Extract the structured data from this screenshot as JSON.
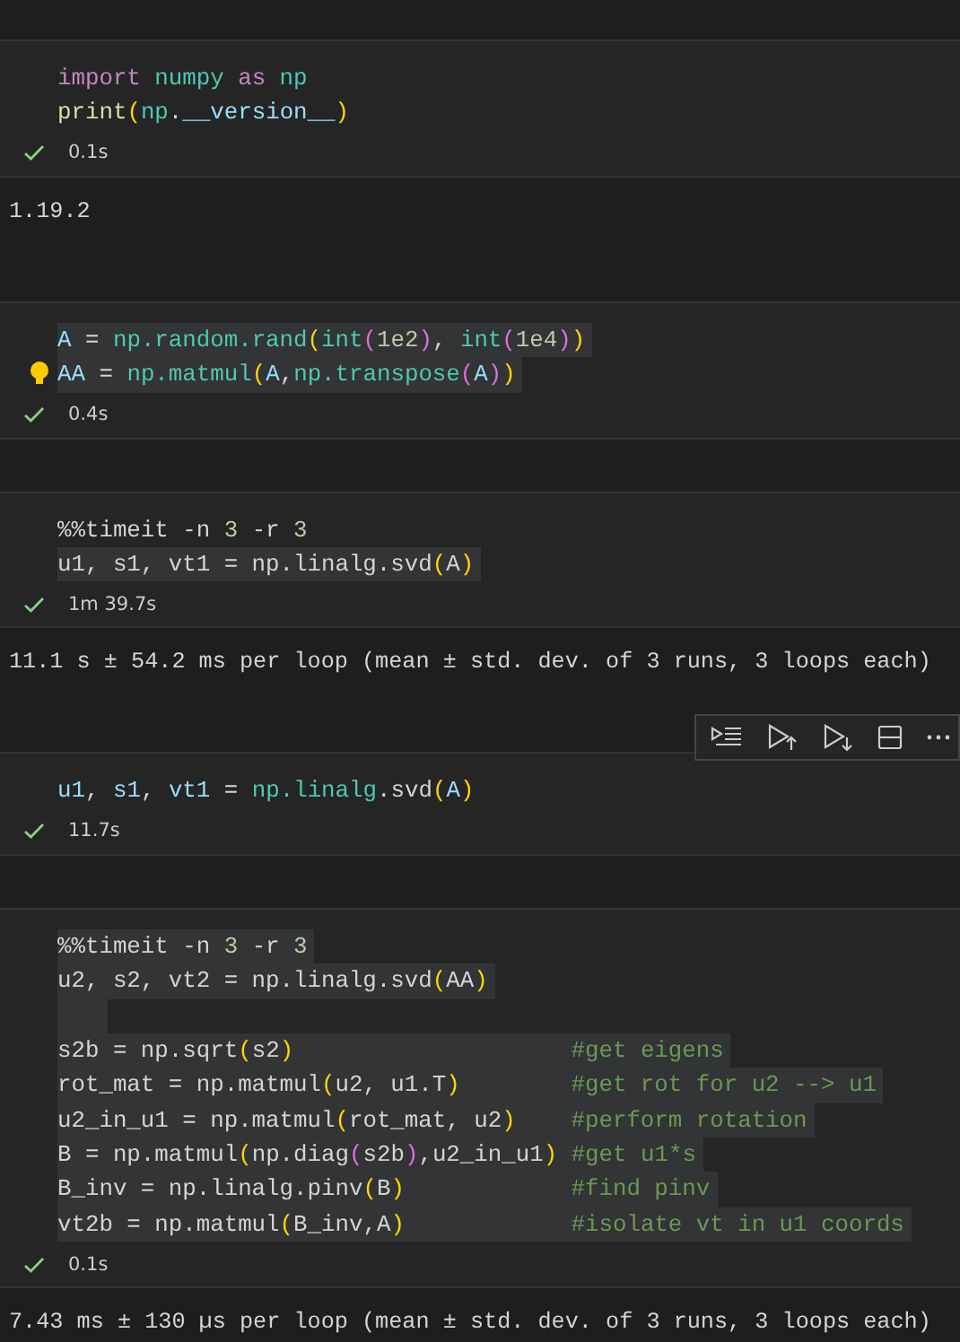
{
  "cells": [
    {
      "toolbar_shown": false,
      "lines": [
        {
          "highlighted": false,
          "tokens": [
            {
              "t": "import",
              "kind": "keyword"
            },
            {
              "t": " numpy",
              "kind": "module"
            },
            {
              "t": " as",
              "kind": "keyword"
            },
            {
              "t": " np",
              "kind": "module"
            }
          ]
        },
        {
          "highlighted": false,
          "tokens": [
            {
              "t": "print",
              "kind": "function"
            },
            {
              "t": "(",
              "kind": "paren1"
            },
            {
              "t": "np",
              "kind": "module"
            },
            {
              "t": ".",
              "kind": "plain"
            },
            {
              "t": "__version__",
              "kind": "variable"
            },
            {
              "t": ")",
              "kind": "paren1"
            }
          ]
        }
      ],
      "status": {
        "succeeded": true,
        "time": "0.1s"
      },
      "output": "1.19.2"
    },
    {
      "toolbar_shown": false,
      "lightbulb": true,
      "lines": [
        {
          "highlighted": true,
          "tokens": [
            {
              "t": "A",
              "kind": "variable"
            },
            {
              "t": " = ",
              "kind": "plain"
            },
            {
              "t": "np.random.rand",
              "kind": "module"
            },
            {
              "t": "(",
              "kind": "paren1"
            },
            {
              "t": "int",
              "kind": "module"
            },
            {
              "t": "(",
              "kind": "paren2"
            },
            {
              "t": "1e2",
              "kind": "number"
            },
            {
              "t": ")",
              "kind": "paren2"
            },
            {
              "t": ", ",
              "kind": "plain"
            },
            {
              "t": "int",
              "kind": "module"
            },
            {
              "t": "(",
              "kind": "paren2"
            },
            {
              "t": "1e4",
              "kind": "number"
            },
            {
              "t": ")",
              "kind": "paren2"
            },
            {
              "t": ")",
              "kind": "paren1"
            }
          ]
        },
        {
          "highlighted": true,
          "tokens": [
            {
              "t": "AA",
              "kind": "variable"
            },
            {
              "t": " = ",
              "kind": "plain"
            },
            {
              "t": "np.matmul",
              "kind": "module"
            },
            {
              "t": "(",
              "kind": "paren1"
            },
            {
              "t": "A",
              "kind": "variable"
            },
            {
              "t": ",",
              "kind": "plain"
            },
            {
              "t": "np.transpose",
              "kind": "module"
            },
            {
              "t": "(",
              "kind": "paren2"
            },
            {
              "t": "A",
              "kind": "variable"
            },
            {
              "t": ")",
              "kind": "paren2"
            },
            {
              "t": ")",
              "kind": "paren1"
            }
          ]
        }
      ],
      "status": {
        "succeeded": true,
        "time": "0.4s"
      }
    },
    {
      "toolbar_shown": false,
      "lines": [
        {
          "highlighted": false,
          "tokens": [
            {
              "t": "%%timeit -n ",
              "kind": "plain"
            },
            {
              "t": "3",
              "kind": "number"
            },
            {
              "t": " -r ",
              "kind": "plain"
            },
            {
              "t": "3",
              "kind": "number"
            }
          ]
        },
        {
          "highlighted": true,
          "tokens": [
            {
              "t": "u1, s1, vt1 = np.linalg.svd",
              "kind": "plain"
            },
            {
              "t": "(",
              "kind": "paren1"
            },
            {
              "t": "A",
              "kind": "plain"
            },
            {
              "t": ")",
              "kind": "paren1"
            }
          ]
        }
      ],
      "status": {
        "succeeded": true,
        "time": "1m 39.7s"
      },
      "output": "11.1 s ± 54.2 ms per loop (mean ± std. dev. of 3 runs, 3 loops each)"
    },
    {
      "toolbar_shown": true,
      "lines": [
        {
          "highlighted": false,
          "tokens": [
            {
              "t": "u1",
              "kind": "variable"
            },
            {
              "t": ", ",
              "kind": "plain"
            },
            {
              "t": "s1",
              "kind": "variable"
            },
            {
              "t": ", ",
              "kind": "plain"
            },
            {
              "t": "vt1",
              "kind": "variable"
            },
            {
              "t": " = ",
              "kind": "plain"
            },
            {
              "t": "np.linalg",
              "kind": "module"
            },
            {
              "t": ".svd",
              "kind": "plain"
            },
            {
              "t": "(",
              "kind": "paren1"
            },
            {
              "t": "A",
              "kind": "variable"
            },
            {
              "t": ")",
              "kind": "paren1"
            }
          ]
        }
      ],
      "status": {
        "succeeded": true,
        "time": "11.7s"
      }
    },
    {
      "toolbar_shown": false,
      "lines": [
        {
          "highlighted": true,
          "tokens": [
            {
              "t": "%%timeit -n ",
              "kind": "plain"
            },
            {
              "t": "3",
              "kind": "number"
            },
            {
              "t": " -r ",
              "kind": "plain"
            },
            {
              "t": "3",
              "kind": "number"
            }
          ]
        },
        {
          "highlighted": true,
          "tokens": [
            {
              "t": "u2, s2, vt2 = np.linalg.svd",
              "kind": "plain"
            },
            {
              "t": "(",
              "kind": "paren1"
            },
            {
              "t": "AA",
              "kind": "plain"
            },
            {
              "t": ")",
              "kind": "paren1"
            }
          ]
        },
        {
          "highlighted": true
        },
        {
          "highlighted": true,
          "tokens": [
            {
              "t": "s2b = np.sqrt",
              "kind": "plain"
            },
            {
              "t": "(",
              "kind": "paren1"
            },
            {
              "t": "s2",
              "kind": "plain"
            },
            {
              "t": ")                    ",
              "kind": "paren1"
            },
            {
              "t": "#get eigens",
              "kind": "comment"
            }
          ]
        },
        {
          "highlighted": true,
          "tokens": [
            {
              "t": "rot_mat = np.matmul",
              "kind": "plain"
            },
            {
              "t": "(",
              "kind": "paren1"
            },
            {
              "t": "u2, u1.T",
              "kind": "plain"
            },
            {
              "t": ")        ",
              "kind": "paren1"
            },
            {
              "t": "#get rot for u2 --> u1",
              "kind": "comment"
            }
          ]
        },
        {
          "highlighted": true,
          "tokens": [
            {
              "t": "u2_in_u1 = np.matmul",
              "kind": "plain"
            },
            {
              "t": "(",
              "kind": "paren1"
            },
            {
              "t": "rot_mat, u2",
              "kind": "plain"
            },
            {
              "t": ")    ",
              "kind": "paren1"
            },
            {
              "t": "#perform rotation",
              "kind": "comment"
            }
          ]
        },
        {
          "highlighted": true,
          "tokens": [
            {
              "t": "B = np.matmul",
              "kind": "plain"
            },
            {
              "t": "(",
              "kind": "paren1"
            },
            {
              "t": "np.diag",
              "kind": "plain"
            },
            {
              "t": "(",
              "kind": "paren2"
            },
            {
              "t": "s2b",
              "kind": "plain"
            },
            {
              "t": ")",
              "kind": "paren2"
            },
            {
              "t": ",u2_in_u1",
              "kind": "plain"
            },
            {
              "t": ") ",
              "kind": "paren1"
            },
            {
              "t": "#get u1*s",
              "kind": "comment"
            }
          ]
        },
        {
          "highlighted": true,
          "tokens": [
            {
              "t": "B_inv = np.linalg.pinv",
              "kind": "plain"
            },
            {
              "t": "(",
              "kind": "paren1"
            },
            {
              "t": "B",
              "kind": "plain"
            },
            {
              "t": ")            ",
              "kind": "paren1"
            },
            {
              "t": "#find pinv",
              "kind": "comment"
            }
          ]
        },
        {
          "highlighted": true,
          "tokens": [
            {
              "t": "vt2b = np.matmul",
              "kind": "plain"
            },
            {
              "t": "(",
              "kind": "paren1"
            },
            {
              "t": "B_inv,A",
              "kind": "plain"
            },
            {
              "t": ")            ",
              "kind": "paren1"
            },
            {
              "t": "#isolate vt in u1 coords",
              "kind": "comment"
            }
          ]
        }
      ],
      "status": {
        "succeeded": true,
        "time": "0.1s"
      },
      "output": "7.43 ms ± 130 µs per loop (mean ± std. dev. of 3 runs, 3 loops each)"
    }
  ]
}
